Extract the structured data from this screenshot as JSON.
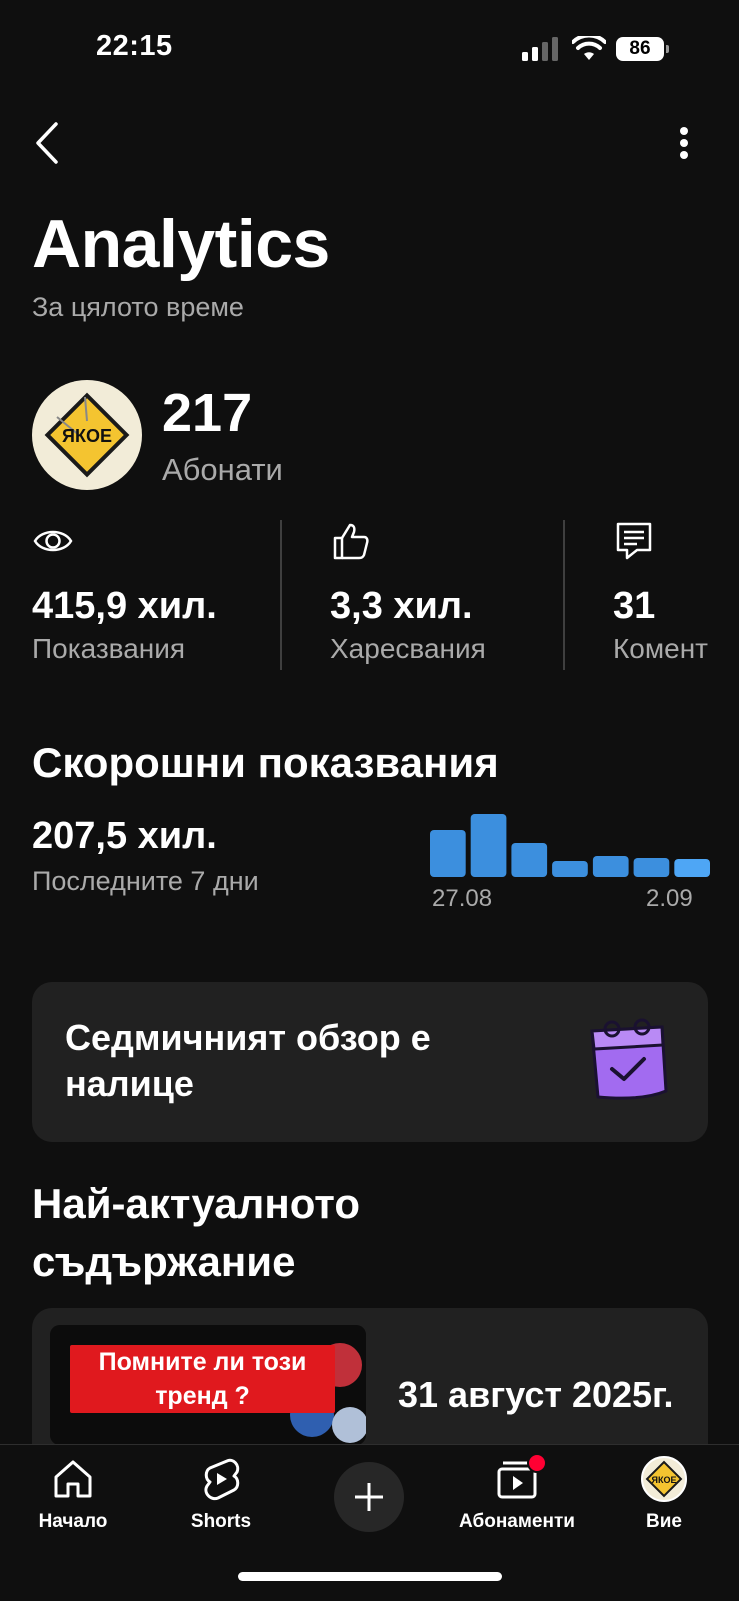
{
  "status_bar": {
    "time": "22:15",
    "battery": "86"
  },
  "header": {
    "title": "Analytics",
    "subtitle": "За цялото време"
  },
  "channel": {
    "avatar_text": "ЯКОЕ",
    "subscribers_value": "217",
    "subscribers_label": "Абонати"
  },
  "stats": [
    {
      "icon": "eye-icon",
      "value": "415,9 хил.",
      "label": "Показвания"
    },
    {
      "icon": "thumbs-up-icon",
      "value": "3,3 хил.",
      "label": "Харесвания"
    },
    {
      "icon": "comment-icon",
      "value": "31",
      "label": "Комент"
    }
  ],
  "recent_views": {
    "title": "Скорошни показвания",
    "value": "207,5 хил.",
    "period": "Последните 7 дни"
  },
  "chart_data": {
    "type": "bar",
    "title": "",
    "xlabel": "",
    "ylabel": "",
    "categories": [
      "27.08",
      "28.08",
      "29.08",
      "30.08",
      "31.08",
      "1.09",
      "2.09"
    ],
    "tick_labels": [
      "27.08",
      "2.09"
    ],
    "values": [
      47,
      63,
      34,
      16,
      21,
      19,
      18
    ],
    "ylim": [
      0,
      70
    ],
    "grid": false,
    "legend": "none",
    "colors": {
      "bar": "#3c8fde",
      "last_bar": "#4ea6f5"
    }
  },
  "weekly_card": {
    "text": "Седмичният обзор е налице",
    "icon": "calendar-check-icon"
  },
  "top_content": {
    "title": "Най-актуалното съдържание",
    "thumbnail_caption": "Помните ли този тренд ?",
    "date_text": "31 август 2025г."
  },
  "bottom_nav": {
    "home": "Начало",
    "shorts": "Shorts",
    "subscriptions": "Абонаменти",
    "you": "Вие"
  },
  "colors": {
    "background": "#0f0f0f",
    "card": "#212121",
    "accent_blue": "#3c8fde",
    "notification_red": "#ff0033",
    "weekly_icon": "#a26bf0"
  }
}
